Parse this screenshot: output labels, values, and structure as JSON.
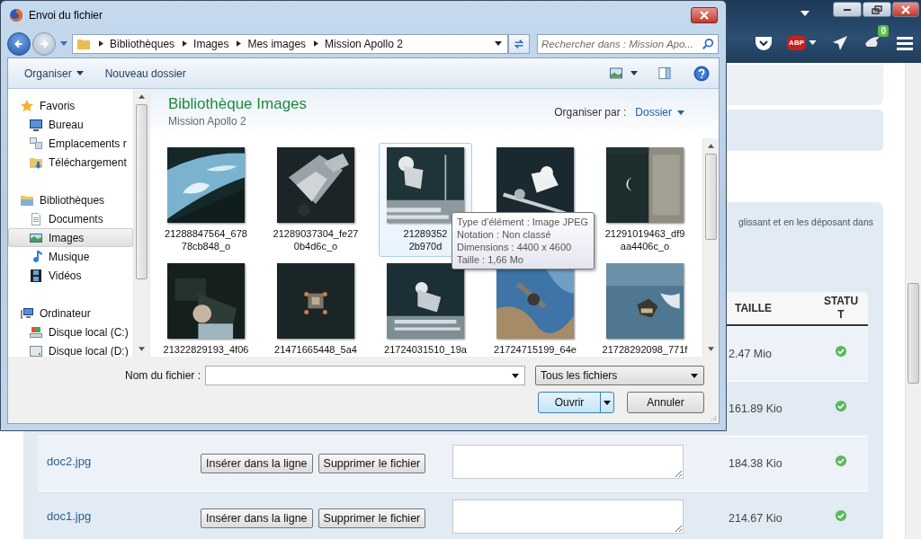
{
  "browser": {
    "adblock": "ABP",
    "badge": "0"
  },
  "page": {
    "note": "glissant et en les déposant dans",
    "table": {
      "columns": [
        "TAILLE",
        "STATUT"
      ],
      "rows": [
        {
          "size": "2.47 Mio"
        },
        {
          "size": "161.89 Kio"
        },
        {
          "name": "doc2.jpg",
          "actions": [
            "Insérer dans la ligne",
            "Supprimer le fichier"
          ],
          "size": "184.38 Kio"
        },
        {
          "name": "doc1.jpg",
          "actions": [
            "Insérer dans la ligne",
            "Supprimer le fichier"
          ],
          "size": "214.67 Kio"
        }
      ]
    }
  },
  "dialog": {
    "title": "Envoi du fichier",
    "breadcrumb": [
      "Bibliothèques",
      "Images",
      "Mes images",
      "Mission Apollo 2"
    ],
    "search": {
      "placeholder": "Rechercher dans : Mission Apo..."
    },
    "toolbar": [
      {
        "label": "Organiser",
        "kind": "menu"
      },
      {
        "label": "Nouveau dossier",
        "kind": "button"
      }
    ],
    "nav": [
      {
        "label": "Favoris",
        "selected": false,
        "children": [
          {
            "label": "Bureau",
            "selected": false
          },
          {
            "label": "Emplacements r",
            "selected": false
          },
          {
            "label": "Téléchargement",
            "selected": false
          }
        ]
      },
      {
        "label": "Bibliothèques",
        "selected": false,
        "children": [
          {
            "label": "Documents",
            "selected": false
          },
          {
            "label": "Images",
            "selected": true
          },
          {
            "label": "Musique",
            "selected": false
          },
          {
            "label": "Vidéos",
            "selected": false
          }
        ]
      },
      {
        "label": "Ordinateur",
        "selected": false,
        "children": [
          {
            "label": "Disque local (C:)",
            "selected": false
          },
          {
            "label": "Disque local (D:)",
            "selected": false
          }
        ]
      }
    ],
    "library": {
      "title": "Bibliothèque Images",
      "subtitle": "Mission Apollo 2",
      "arrange_label": "Organiser par :",
      "arrange_value": "Dossier"
    },
    "files": [
      {
        "kind": "picture",
        "lines": [
          "21288847564_678",
          "78cb848_o"
        ],
        "selected": false
      },
      {
        "kind": "picture",
        "lines": [
          "21289037304_fe27",
          "0b4d6c_o"
        ],
        "selected": false
      },
      {
        "kind": "picture",
        "lines": [
          "21289352",
          "2b970d"
        ],
        "selected": true
      },
      {
        "kind": "picture",
        "selected": false
      },
      {
        "kind": "picture",
        "lines": [
          "21291019463_df9",
          "aa4406c_o"
        ],
        "selected": false
      },
      {
        "kind": "picture",
        "lines": [
          "21322829193_4f06"
        ],
        "selected": false
      },
      {
        "kind": "picture",
        "lines": [
          "21471665448_5a4"
        ],
        "selected": false
      },
      {
        "kind": "picture",
        "lines": [
          "21724031510_19a"
        ],
        "selected": false
      },
      {
        "kind": "picture",
        "lines": [
          "21724715199_64e"
        ],
        "selected": false
      },
      {
        "kind": "picture",
        "lines": [
          "21728292098_771f"
        ],
        "selected": false
      }
    ],
    "tooltip": [
      "Type d’élément : Image JPEG",
      "Notation : Non classé",
      "Dimensions : 4400 x 4600",
      "Taille : 1,66 Mo"
    ],
    "filename_label": "Nom du fichier :",
    "filter": "Tous les fichiers",
    "buttons": [
      {
        "label": "Ouvrir",
        "kind": "split"
      },
      {
        "label": "Annuler",
        "kind": "plain"
      }
    ]
  }
}
